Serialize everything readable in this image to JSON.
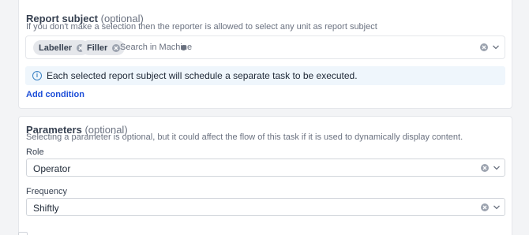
{
  "report_subject": {
    "title": "Report subject",
    "optional": "(optional)",
    "description": "If you don't make a selection then the reporter is allowed to select any unit as report subject",
    "tags": [
      "Labeller",
      "Filler"
    ],
    "search_placeholder": "Search in Machine",
    "info": "Each selected report subject will schedule a separate task to be executed.",
    "add_condition": "Add condition"
  },
  "parameters": {
    "title": "Parameters",
    "optional": "(optional)",
    "description": "Selecting a parameter is optional, but it could affect the flow of this task if it is used to dynamically display content.",
    "role_label": "Role",
    "role_value": "Operator",
    "frequency_label": "Frequency",
    "frequency_value": "Shiftly"
  },
  "colors": {
    "link": "#1d4ed8",
    "info_bg": "#eff6fc",
    "info_icon": "#3b82c4"
  }
}
